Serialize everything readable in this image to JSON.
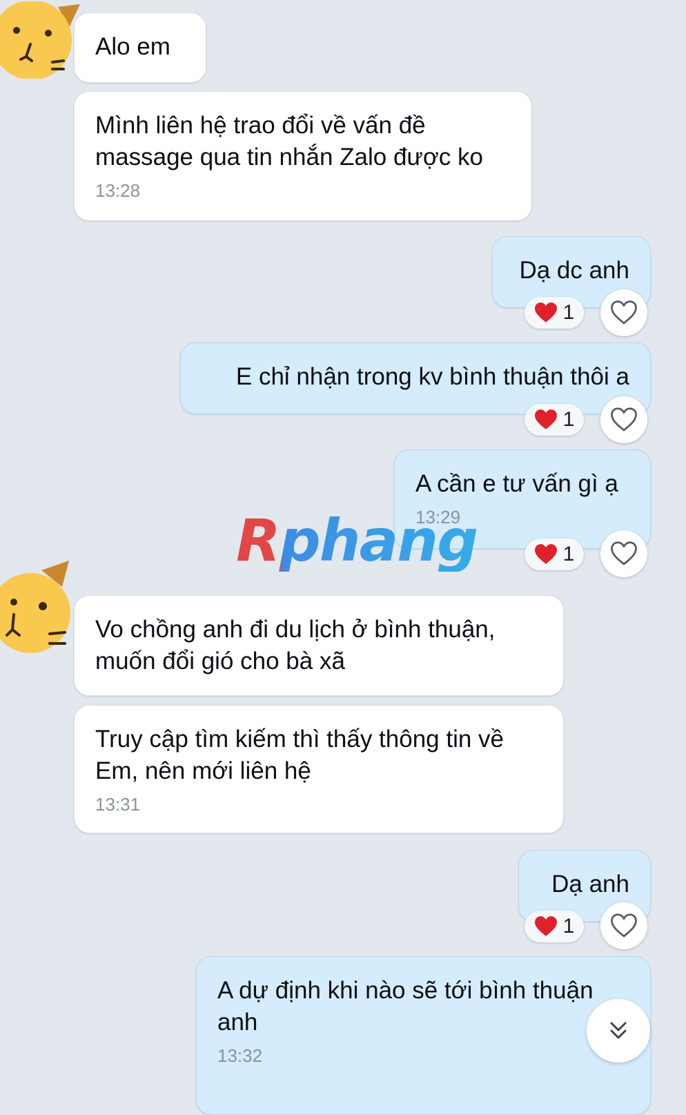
{
  "messages": [
    {
      "text": "Alo em",
      "time": ""
    },
    {
      "text": "Mình liên hệ trao đổi về vấn đề massage qua tin nhắn Zalo được ko",
      "time": "13:28"
    },
    {
      "text": "Dạ dc anh",
      "time": "",
      "reaction_count": "1"
    },
    {
      "text": "E chỉ nhận trong kv bình thuận thôi a",
      "time": "",
      "reaction_count": "1"
    },
    {
      "text": "A cần e tư vấn gì ạ",
      "time": "13:29",
      "reaction_count": "1"
    },
    {
      "text": "Vo chồng anh đi du lịch ở bình thuận, muốn đổi gió cho bà xã",
      "time": ""
    },
    {
      "text": "Truy cập tìm kiếm thì thấy thông tin về Em, nên mới liên hệ",
      "time": "13:31"
    },
    {
      "text": "Dạ anh",
      "time": "",
      "reaction_count": "1"
    },
    {
      "text": "A dự định khi nào sẽ tới bình thuận anh",
      "time": "13:32"
    }
  ],
  "watermark": "Rphang",
  "icons": {
    "avatar": "cat-avatar-icon",
    "reaction": "red-heart-icon",
    "like": "heart-outline-icon",
    "scroll": "double-chevron-down-icon"
  },
  "colors": {
    "background": "#e3e8ef",
    "incoming_bubble": "#ffffff",
    "outgoing_bubble": "#d4ecfc",
    "reaction_heart": "#e0202b",
    "avatar": "#f9c84f"
  }
}
